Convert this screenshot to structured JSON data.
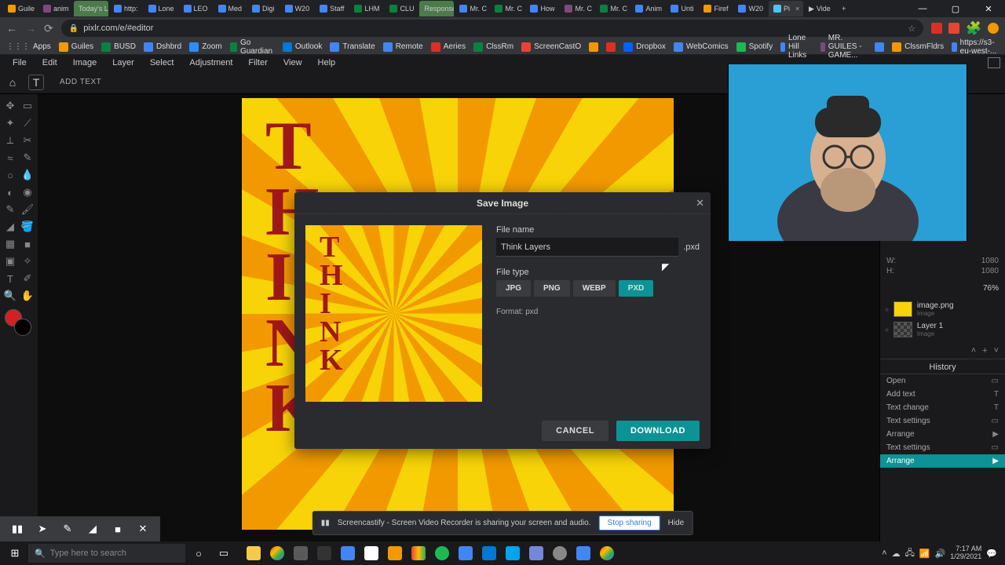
{
  "browser": {
    "tabs": [
      "Guile",
      "anim",
      "Today's Lesson",
      "http:",
      "Lone",
      "LEO",
      "Med",
      "Digi",
      "W20",
      "Staff",
      "LHM",
      "CLU",
      "Responses",
      "Mr. C",
      "Mr. C",
      "How",
      "Mr. C",
      "Mr. C",
      "Anim",
      "Unti",
      "Firef",
      "W20",
      "Pi",
      "Vide"
    ],
    "url": "pixlr.com/e/#editor",
    "bookmarks": [
      "Apps",
      "Guiles",
      "BUSD",
      "Dshbrd",
      "Zoom",
      "Go Guardian",
      "Outlook",
      "Translate",
      "Remote",
      "Aeries",
      "ClssRm",
      "ScreenCastO",
      "",
      "",
      "Dropbox",
      "WebComics",
      "Spotify",
      "Lone Hill Links",
      "MR. GUILES -GAME...",
      "",
      "ClssmFldrs",
      "https://s3-eu-west-..."
    ]
  },
  "menubar": [
    "File",
    "Edit",
    "Image",
    "Layer",
    "Select",
    "Adjustment",
    "Filter",
    "View",
    "Help"
  ],
  "toolbar": {
    "add_text": "ADD TEXT"
  },
  "canvas": {
    "think": "T\nH\nI\nN\nK"
  },
  "modal": {
    "title": "Save Image",
    "filename_label": "File name",
    "filename_value": "Think Layers",
    "ext": ".pxd",
    "filetype_label": "File type",
    "filetypes": [
      "JPG",
      "PNG",
      "WEBP",
      "PXD"
    ],
    "active_filetype": "PXD",
    "format": "Format: pxd",
    "cancel": "CANCEL",
    "download": "DOWNLOAD"
  },
  "info": {
    "w_label": "W:",
    "w": "1080",
    "h_label": "H:",
    "h": "1080",
    "zoom": "76%"
  },
  "layers": [
    {
      "name": "image.png",
      "sub": "Image"
    },
    {
      "name": "Layer 1",
      "sub": "Image"
    }
  ],
  "history": {
    "title": "History",
    "items": [
      "Open",
      "Add text",
      "Text change",
      "Text settings",
      "Arrange",
      "Text settings",
      "Arrange"
    ]
  },
  "share": {
    "msg": "Screencastify - Screen Video Recorder is sharing your screen and audio.",
    "stop": "Stop sharing",
    "hide": "Hide"
  },
  "taskbar": {
    "search_placeholder": "Type here to search",
    "time": "7:17 AM",
    "date": "1/29/2021"
  }
}
